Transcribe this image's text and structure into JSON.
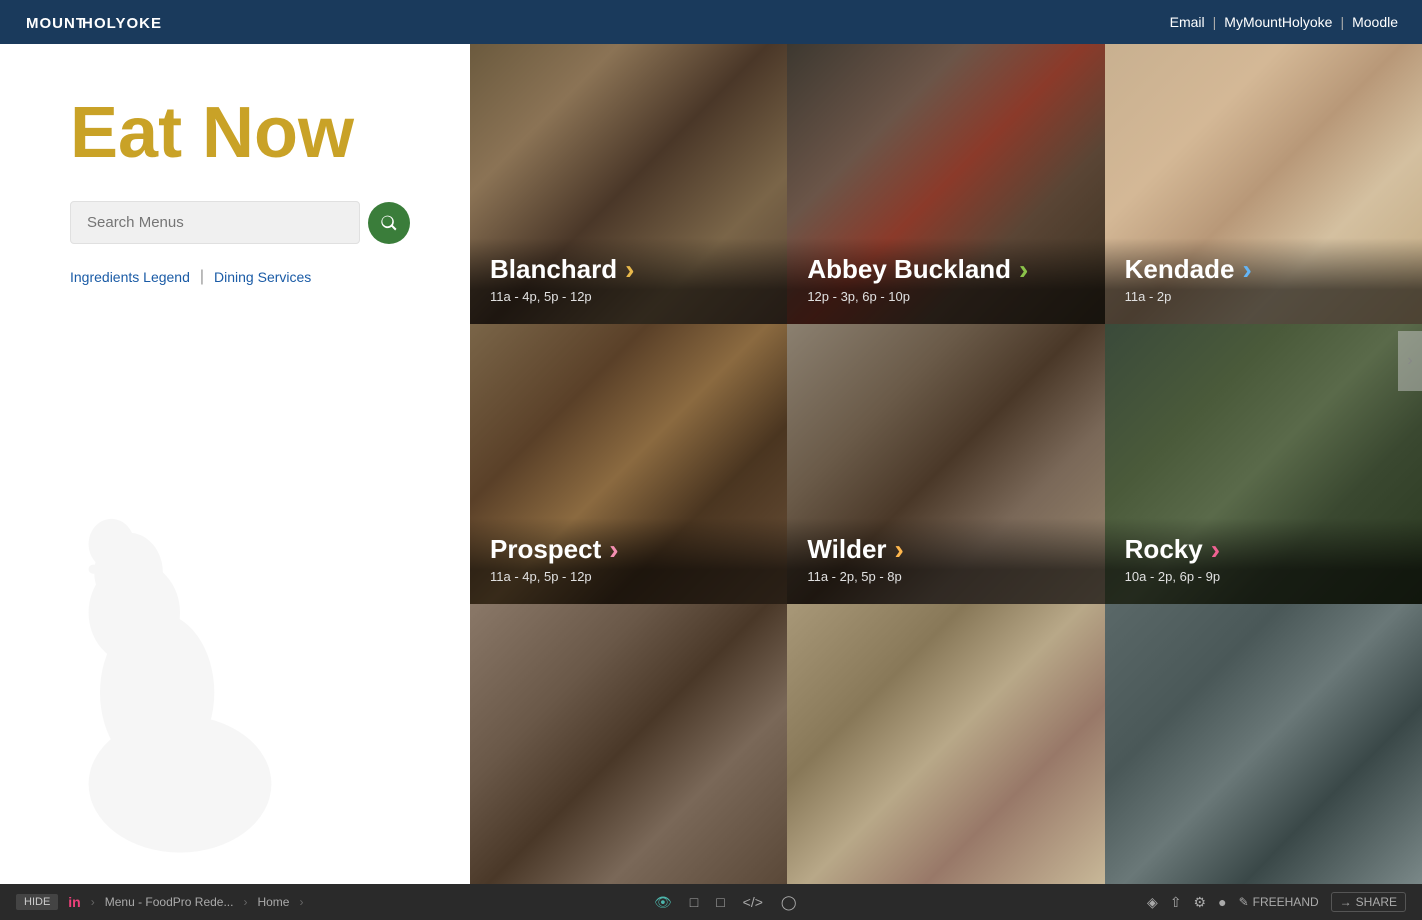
{
  "topNav": {
    "logo": "MOUNTHOLYOKE",
    "links": [
      {
        "label": "Email",
        "href": "#"
      },
      {
        "label": "MyMountHolyoke",
        "href": "#"
      },
      {
        "label": "Moodle",
        "href": "#"
      }
    ]
  },
  "sidebar": {
    "title": "Eat Now",
    "search": {
      "placeholder": "Search Menus"
    },
    "links": [
      {
        "label": "Ingredients Legend",
        "href": "#"
      },
      {
        "label": "Dining Services",
        "href": "#"
      }
    ]
  },
  "diningCards": [
    {
      "name": "Blanchard",
      "hours": "11a - 4p, 5p - 12p",
      "bgClass": "food-bg-1",
      "arrowClass": "arrow-yellow"
    },
    {
      "name": "Abbey Buckland",
      "hours": "12p - 3p, 6p - 10p",
      "bgClass": "food-bg-2",
      "arrowClass": "arrow-green"
    },
    {
      "name": "Kendade",
      "hours": "11a - 2p",
      "bgClass": "food-bg-3",
      "arrowClass": "arrow-blue"
    },
    {
      "name": "Prospect",
      "hours": "11a - 4p, 5p - 12p",
      "bgClass": "food-bg-4",
      "arrowClass": "arrow-pink"
    },
    {
      "name": "Wilder",
      "hours": "11a - 2p, 5p - 8p",
      "bgClass": "food-bg-5",
      "arrowClass": "arrow-orange"
    },
    {
      "name": "Rocky",
      "hours": "10a - 2p, 6p - 9p",
      "bgClass": "food-bg-6",
      "arrowClass": "arrow-magenta"
    },
    {
      "name": "",
      "hours": "",
      "bgClass": "food-bg-7",
      "arrowClass": ""
    },
    {
      "name": "",
      "hours": "",
      "bgClass": "food-bg-8",
      "arrowClass": ""
    },
    {
      "name": "",
      "hours": "",
      "bgClass": "food-bg-9",
      "arrowClass": ""
    }
  ],
  "bottomBar": {
    "hideLabel": "HIDE",
    "breadcrumbs": [
      "in",
      "Menu - FoodPro Rede...",
      "Home"
    ],
    "freehandLabel": "FREEHAND",
    "shareLabel": "SHARE"
  }
}
